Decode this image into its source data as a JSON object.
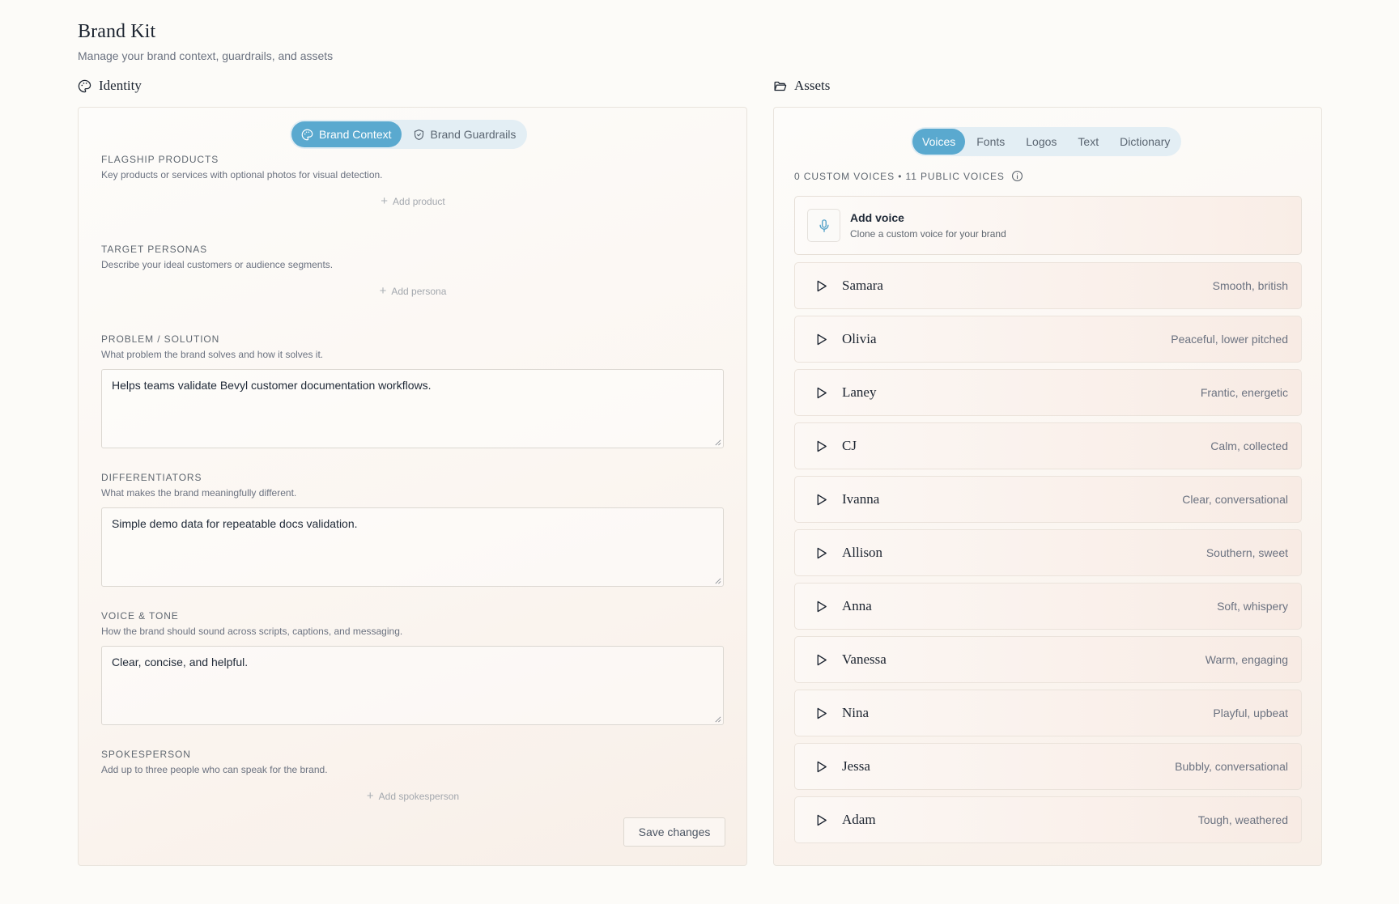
{
  "header": {
    "title": "Brand Kit",
    "subtitle": "Manage your brand context, guardrails, and assets"
  },
  "identity": {
    "heading": "Identity",
    "heading_icon": "palette-icon",
    "tabs": [
      {
        "label": "Brand Context",
        "icon": "palette-icon",
        "active": true
      },
      {
        "label": "Brand Guardrails",
        "icon": "shield-icon",
        "active": false
      }
    ],
    "sections": {
      "flagship": {
        "label": "FLAGSHIP PRODUCTS",
        "help": "Key products or services with optional photos for visual detection.",
        "add_label": "Add product"
      },
      "personas": {
        "label": "TARGET PERSONAS",
        "help": "Describe your ideal customers or audience segments.",
        "add_label": "Add persona"
      },
      "problem": {
        "label": "PROBLEM / SOLUTION",
        "help": "What problem the brand solves and how it solves it.",
        "value": "Helps teams validate Bevyl customer documentation workflows."
      },
      "differentiators": {
        "label": "DIFFERENTIATORS",
        "help": "What makes the brand meaningfully different.",
        "value": "Simple demo data for repeatable docs validation."
      },
      "voice_tone": {
        "label": "VOICE & TONE",
        "help": "How the brand should sound across scripts, captions, and messaging.",
        "value": "Clear, concise, and helpful."
      },
      "spokesperson": {
        "label": "SPOKESPERSON",
        "help": "Add up to three people who can speak for the brand.",
        "add_label": "Add spokesperson"
      }
    },
    "save_label": "Save changes"
  },
  "assets": {
    "heading": "Assets",
    "heading_icon": "folder-open-icon",
    "tabs": [
      {
        "label": "Voices",
        "active": true
      },
      {
        "label": "Fonts",
        "active": false
      },
      {
        "label": "Logos",
        "active": false
      },
      {
        "label": "Text",
        "active": false
      },
      {
        "label": "Dictionary",
        "active": false
      }
    ],
    "voices_count": "0 CUSTOM VOICES • 11 PUBLIC VOICES",
    "add_voice": {
      "title": "Add voice",
      "subtitle": "Clone a custom voice for your brand"
    },
    "voices": [
      {
        "name": "Samara",
        "description": "Smooth, british"
      },
      {
        "name": "Olivia",
        "description": "Peaceful, lower pitched"
      },
      {
        "name": "Laney",
        "description": "Frantic, energetic"
      },
      {
        "name": "CJ",
        "description": "Calm, collected"
      },
      {
        "name": "Ivanna",
        "description": "Clear, conversational"
      },
      {
        "name": "Allison",
        "description": "Southern, sweet"
      },
      {
        "name": "Anna",
        "description": "Soft, whispery"
      },
      {
        "name": "Vanessa",
        "description": "Warm, engaging"
      },
      {
        "name": "Nina",
        "description": "Playful, upbeat"
      },
      {
        "name": "Jessa",
        "description": "Bubbly, conversational"
      },
      {
        "name": "Adam",
        "description": "Tough, weathered"
      }
    ]
  },
  "colors": {
    "accent": "#5aa9cf",
    "background": "#fcfbf8",
    "toggle_track": "#e3eef4"
  }
}
